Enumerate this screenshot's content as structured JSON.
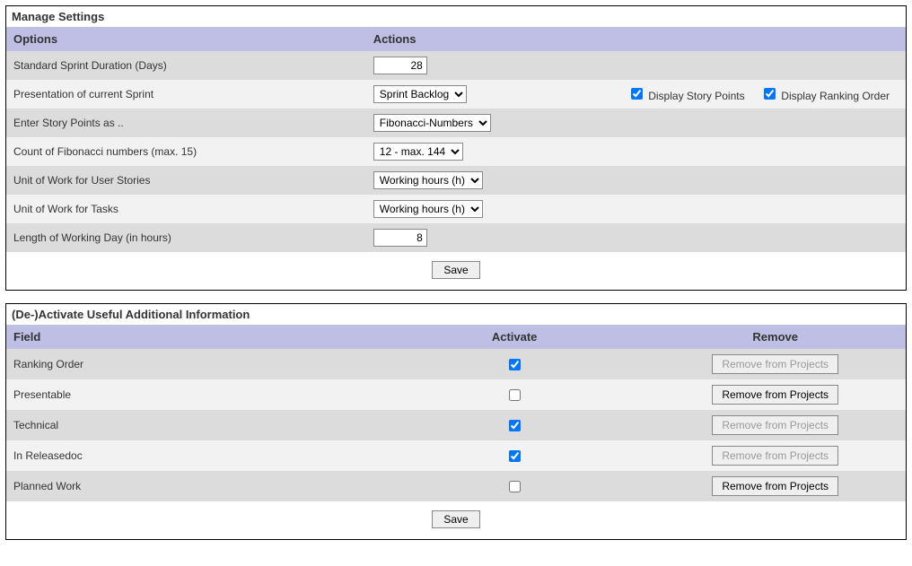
{
  "panel1": {
    "title": "Manage Settings",
    "headers": {
      "options": "Options",
      "actions": "Actions"
    },
    "rows": {
      "sprintDuration": {
        "label": "Standard Sprint Duration (Days)",
        "value": "28"
      },
      "presentation": {
        "label": "Presentation of current Sprint",
        "value": "Sprint Backlog",
        "displayStoryPoints": {
          "label": "Display Story Points",
          "checked": true
        },
        "displayRankingOrder": {
          "label": "Display Ranking Order",
          "checked": true
        }
      },
      "storyPointsAs": {
        "label": "Enter Story Points as ..",
        "value": "Fibonacci-Numbers"
      },
      "fibCount": {
        "label": "Count of Fibonacci numbers (max. 15)",
        "value": "12 - max. 144"
      },
      "unitUserStories": {
        "label": "Unit of Work for User Stories",
        "value": "Working hours (h)"
      },
      "unitTasks": {
        "label": "Unit of Work for Tasks",
        "value": "Working hours (h)"
      },
      "workingDayLength": {
        "label": "Length of Working Day (in hours)",
        "value": "8"
      }
    },
    "saveLabel": "Save"
  },
  "panel2": {
    "title": "(De-)Activate Useful Additional Information",
    "headers": {
      "field": "Field",
      "activate": "Activate",
      "remove": "Remove"
    },
    "removeLabel": "Remove from Projects",
    "rows": [
      {
        "field": "Ranking Order",
        "checked": true,
        "removeEnabled": false
      },
      {
        "field": "Presentable",
        "checked": false,
        "removeEnabled": true
      },
      {
        "field": "Technical",
        "checked": true,
        "removeEnabled": false
      },
      {
        "field": "In Releasedoc",
        "checked": true,
        "removeEnabled": false
      },
      {
        "field": "Planned Work",
        "checked": false,
        "removeEnabled": true
      }
    ],
    "saveLabel": "Save"
  }
}
